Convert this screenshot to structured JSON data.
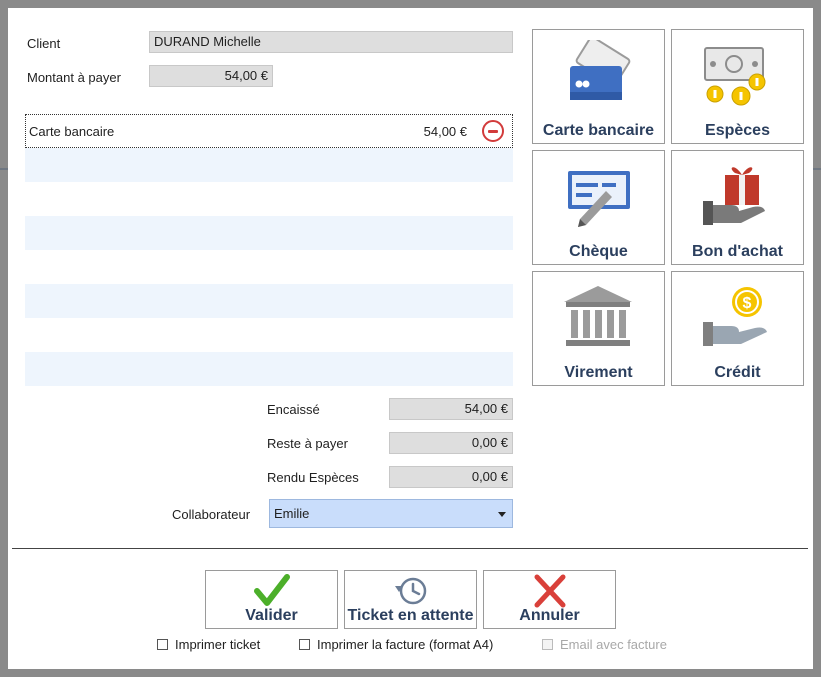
{
  "form": {
    "client_label": "Client",
    "client_value": "DURAND Michelle",
    "amount_label": "Montant à payer",
    "amount_value": "54,00 €"
  },
  "payments": [
    {
      "method": "Carte bancaire",
      "amount": "54,00 €"
    }
  ],
  "totals": {
    "collected_label": "Encaissé",
    "collected_value": "54,00 €",
    "remaining_label": "Reste à payer",
    "remaining_value": "0,00 €",
    "change_label": "Rendu Espèces",
    "change_value": "0,00 €"
  },
  "collaborator": {
    "label": "Collaborateur",
    "selected": "Emilie"
  },
  "methods": [
    {
      "label": "Carte bancaire",
      "icon": "credit-card-icon"
    },
    {
      "label": "Espèces",
      "icon": "cash-coins-icon"
    },
    {
      "label": "Chèque",
      "icon": "cheque-pen-icon"
    },
    {
      "label": "Bon d'achat",
      "icon": "gift-voucher-icon"
    },
    {
      "label": "Virement",
      "icon": "bank-building-icon"
    },
    {
      "label": "Crédit",
      "icon": "credit-coin-hand-icon"
    }
  ],
  "actions": {
    "validate": "Valider",
    "hold": "Ticket en attente",
    "cancel": "Annuler"
  },
  "options": {
    "print_ticket": "Imprimer ticket",
    "print_invoice": "Imprimer la facture (format A4)",
    "email_invoice": "Email avec facture"
  },
  "colors": {
    "label_navy": "#2b3f5e",
    "remove_red": "#d23b3b",
    "select_blue": "#c9ddfb",
    "stripe_blue": "#eef5fd",
    "valid_green": "#4caf2a"
  }
}
